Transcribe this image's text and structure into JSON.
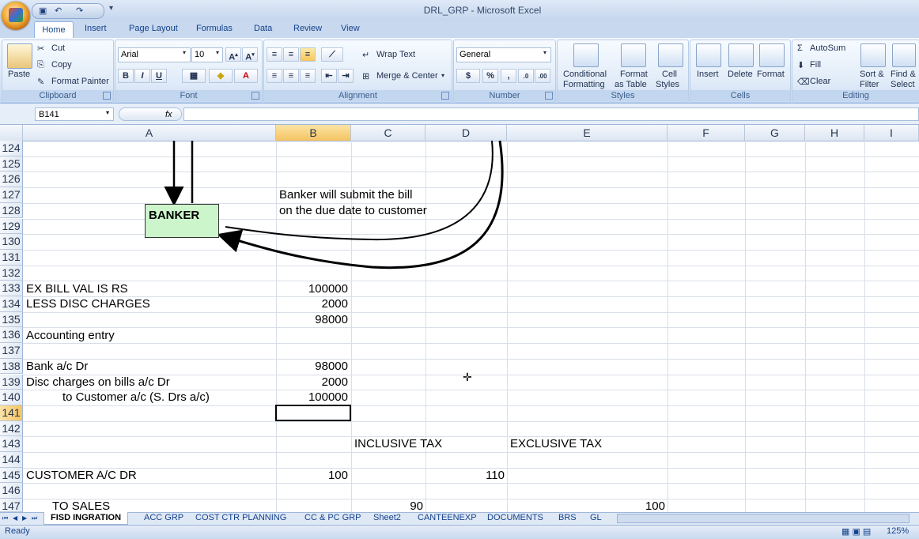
{
  "app": {
    "title": "DRL_GRP - Microsoft Excel"
  },
  "ribbon": {
    "tabs": [
      "Home",
      "Insert",
      "Page Layout",
      "Formulas",
      "Data",
      "Review",
      "View"
    ],
    "clipboard": {
      "label": "Clipboard",
      "paste": "Paste",
      "cut": "Cut",
      "copy": "Copy",
      "format_painter": "Format Painter"
    },
    "font": {
      "label": "Font",
      "name": "Arial",
      "size": "10"
    },
    "alignment": {
      "label": "Alignment",
      "wrap": "Wrap Text",
      "merge": "Merge & Center"
    },
    "number": {
      "label": "Number",
      "format": "General",
      "currency": "$",
      "percent": "%",
      "comma": ","
    },
    "styles": {
      "label": "Styles",
      "conditional": "Conditional",
      "conditional2": "Formatting",
      "format_table": "Format",
      "format_table2": "as Table",
      "cell_styles": "Cell",
      "cell_styles2": "Styles"
    },
    "cells": {
      "label": "Cells",
      "insert": "Insert",
      "delete": "Delete",
      "format": "Format"
    },
    "editing": {
      "label": "Editing",
      "autosum": "AutoSum",
      "fill": "Fill",
      "clear": "Clear",
      "sort": "Sort &",
      "sort2": "Filter",
      "find": "Find &",
      "find2": "Select"
    }
  },
  "formula_bar": {
    "name_box": "B141",
    "fx": "fx",
    "value": ""
  },
  "columns": [
    "A",
    "B",
    "C",
    "D",
    "E",
    "F",
    "G",
    "H",
    "I"
  ],
  "rows": [
    "124",
    "125",
    "126",
    "127",
    "128",
    "129",
    "130",
    "131",
    "132",
    "133",
    "134",
    "135",
    "136",
    "137",
    "138",
    "139",
    "140",
    "141",
    "142",
    "143",
    "144",
    "145",
    "146",
    "147"
  ],
  "cells": {
    "banker_box": "BANKER",
    "note1": "Banker will submit the bill",
    "note2": "on the due date to customer",
    "a133": "EX  BILL VAL IS RS",
    "b133": "100000",
    "a134": "LESS DISC CHARGES",
    "b134": "2000",
    "b135": "98000",
    "a136": "Accounting entry",
    "a138": "Bank a/c  Dr",
    "b138": "98000",
    "a139": "Disc charges on bills a/c Dr",
    "b139": "2000",
    "a140": "to Customer a/c (S. Drs a/c)",
    "b140": "100000",
    "c143": "INCLUSIVE TAX",
    "e143": "EXCLUSIVE TAX",
    "a145": "CUSTOMER A/C DR",
    "b145": "100",
    "d145": "110",
    "a147": "TO SALES",
    "c147": "90",
    "e147": "100"
  },
  "sheet_tabs": [
    "FISD INGRATION",
    "ACC GRP",
    "COST CTR PLANNING",
    "CC & PC GRP",
    "Sheet2",
    "CANTEENEXP",
    "DOCUMENTS",
    "BRS",
    "GL"
  ],
  "status": {
    "ready": "Ready",
    "zoom": "125%"
  }
}
